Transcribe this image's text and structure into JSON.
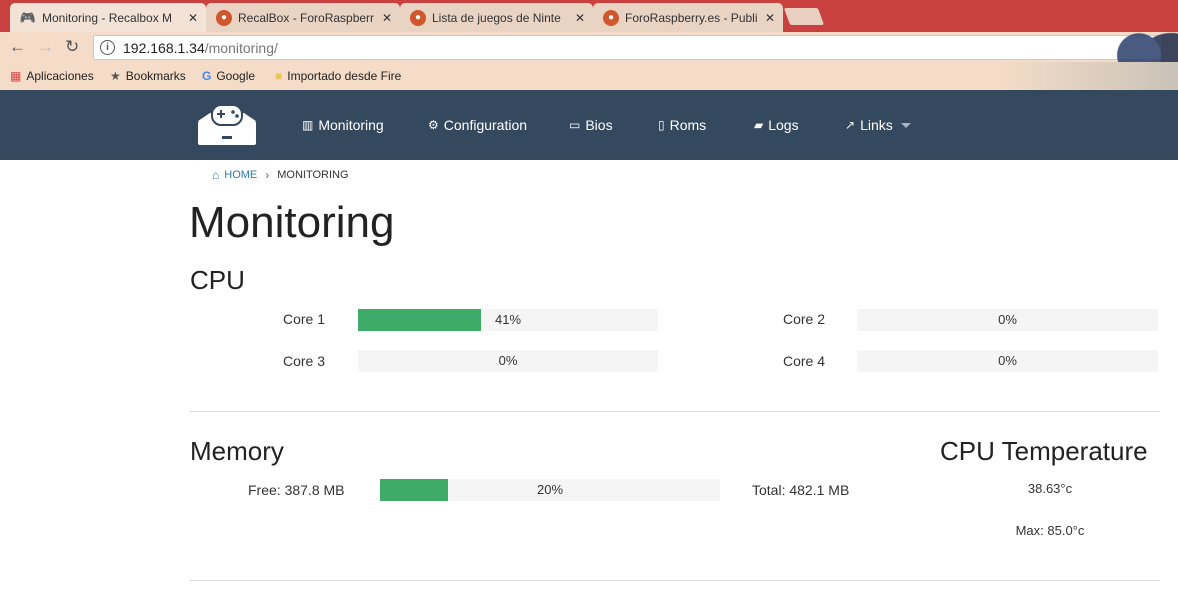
{
  "tabs": [
    {
      "title": "Monitoring - Recalbox M",
      "active": true,
      "icon": "gamepad-icon"
    },
    {
      "title": "RecalBox - ForoRaspberr",
      "active": false,
      "icon": "raspberry-icon"
    },
    {
      "title": "Lista de juegos de Ninte",
      "active": false,
      "icon": "raspberry-icon"
    },
    {
      "title": "ForoRaspberry.es - Publi",
      "active": false,
      "icon": "raspberry-icon"
    }
  ],
  "address": {
    "host": "192.168.1.34",
    "path": "/monitoring/"
  },
  "bookmarks": [
    {
      "label": "Aplicaciones",
      "icon": "apps-grid-icon"
    },
    {
      "label": "Bookmarks",
      "icon": "star-icon"
    },
    {
      "label": "Google",
      "icon": "google-icon"
    },
    {
      "label": "Importado desde Fire",
      "icon": "folder-icon"
    }
  ],
  "nav": [
    {
      "label": "Monitoring",
      "icon": "bar-chart-icon"
    },
    {
      "label": "Configuration",
      "icon": "gears-icon"
    },
    {
      "label": "Bios",
      "icon": "chip-icon"
    },
    {
      "label": "Roms",
      "icon": "book-icon"
    },
    {
      "label": "Logs",
      "icon": "note-icon"
    },
    {
      "label": "Links",
      "icon": "external-link-icon"
    }
  ],
  "breadcrumb": {
    "home": "HOME",
    "current": "MONITORING"
  },
  "page_title": "Monitoring",
  "cpu": {
    "heading": "CPU",
    "cores": [
      {
        "label": "Core 1",
        "percent": 41,
        "text": "41%"
      },
      {
        "label": "Core 2",
        "percent": 0,
        "text": "0%"
      },
      {
        "label": "Core 3",
        "percent": 0,
        "text": "0%"
      },
      {
        "label": "Core 4",
        "percent": 0,
        "text": "0%"
      }
    ]
  },
  "memory": {
    "heading": "Memory",
    "free": "Free: 387.8 MB",
    "percent": 20,
    "text": "20%",
    "total": "Total: 482.1 MB"
  },
  "temperature": {
    "heading": "CPU Temperature",
    "current": "38.63°c",
    "max": "Max: 85.0°c"
  },
  "colors": {
    "navbar": "#34495e",
    "progress": "#3fab69",
    "link": "#2a7ab0",
    "tabbar": "#c9413f"
  }
}
